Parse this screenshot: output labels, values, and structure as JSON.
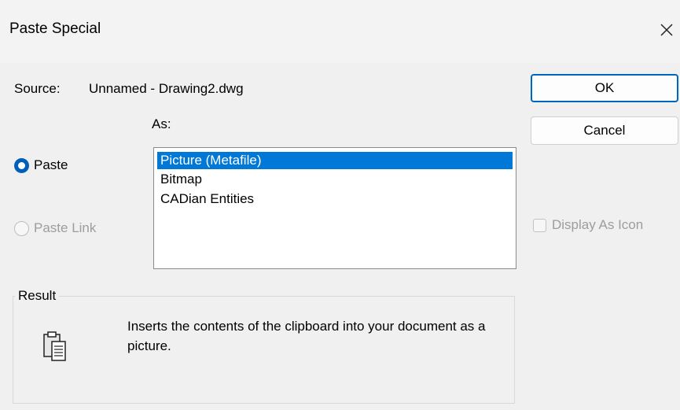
{
  "window": {
    "title": "Paste Special"
  },
  "source": {
    "label": "Source:",
    "value": "Unnamed - Drawing2.dwg"
  },
  "as_label": "As:",
  "buttons": {
    "ok": "OK",
    "cancel": "Cancel"
  },
  "radios": {
    "paste": {
      "label": "Paste",
      "checked": true
    },
    "paste_link": {
      "label": "Paste Link",
      "enabled": false
    }
  },
  "list": {
    "items": [
      "Picture (Metafile)",
      "Bitmap",
      "CADian Entities"
    ],
    "selected_index": 0
  },
  "display_as_icon": {
    "label": "Display As Icon",
    "checked": false,
    "enabled": false
  },
  "result": {
    "label": "Result",
    "text": "Inserts the contents of the clipboard into your document as a picture."
  },
  "icons": {
    "close": "close-icon",
    "result": "clipboard-picture-icon"
  },
  "colors": {
    "accent": "#0067c0",
    "selection": "#0078d7",
    "disabled_text": "#9d9d9d"
  }
}
